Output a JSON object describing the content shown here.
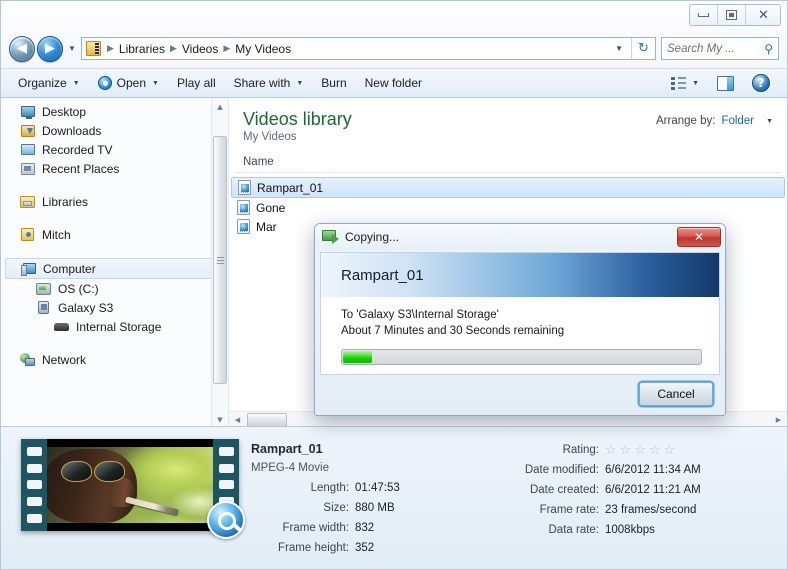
{
  "window": {
    "controls": {
      "minimize": "Minimize",
      "maximize": "Restore",
      "close": "✕"
    }
  },
  "address": {
    "back_label": "◀",
    "forward_label": "▶",
    "history_caret": "▼",
    "crumbs": [
      "Libraries",
      "Videos",
      "My Videos"
    ],
    "separator": "▶",
    "dropdown_caret": "▼",
    "refresh_label": "↻"
  },
  "search": {
    "placeholder": "Search My ...",
    "icon": "search-icon",
    "glyph": "⚲"
  },
  "toolbar": {
    "organize": "Organize",
    "open": "Open",
    "play_all": "Play all",
    "share_with": "Share with",
    "burn": "Burn",
    "new_folder": "New folder",
    "caret": "▼",
    "help_glyph": "?"
  },
  "sidebar": {
    "groups": [
      {
        "items": [
          {
            "label": "Desktop",
            "icon": "desktop-icon",
            "level": 1
          },
          {
            "label": "Downloads",
            "icon": "downloads-icon",
            "level": 1
          },
          {
            "label": "Recorded TV",
            "icon": "recorded-tv-icon",
            "level": 1
          },
          {
            "label": "Recent Places",
            "icon": "recent-places-icon",
            "level": 1
          }
        ]
      },
      {
        "items": [
          {
            "label": "Libraries",
            "icon": "libraries-icon",
            "level": 0
          }
        ]
      },
      {
        "items": [
          {
            "label": "Mitch",
            "icon": "user-folder-icon",
            "level": 0
          }
        ]
      },
      {
        "items": [
          {
            "label": "Computer",
            "icon": "computer-icon",
            "level": 0,
            "selected": true
          },
          {
            "label": "OS (C:)",
            "icon": "hard-drive-icon",
            "level": 1
          },
          {
            "label": "Galaxy S3",
            "icon": "phone-icon",
            "level": 1
          },
          {
            "label": "Internal Storage",
            "icon": "internal-storage-icon",
            "level": 2
          }
        ]
      },
      {
        "items": [
          {
            "label": "Network",
            "icon": "network-icon",
            "level": 0
          }
        ]
      }
    ]
  },
  "library": {
    "title": "Videos library",
    "subtitle": "My Videos",
    "arrange_label": "Arrange by:",
    "arrange_value": "Folder",
    "arrange_caret": "▼",
    "column_header": "Name",
    "files": [
      {
        "name": "Rampart_01",
        "selected": true
      },
      {
        "name": "Gone",
        "selected": false
      },
      {
        "name": "Mar",
        "selected": false
      }
    ]
  },
  "dialog": {
    "title": "Copying...",
    "close_label": "✕",
    "file_name": "Rampart_01",
    "destination_line": "To 'Galaxy S3\\Internal Storage'",
    "time_remaining_line": "About 7 Minutes and 30 Seconds remaining",
    "progress_percent": 8,
    "cancel_label": "Cancel"
  },
  "details": {
    "file_title": "Rampart_01",
    "file_type": "MPEG-4 Movie",
    "left_fields": [
      {
        "label": "Length:",
        "value": "01:47:53"
      },
      {
        "label": "Size:",
        "value": "880 MB"
      },
      {
        "label": "Frame width:",
        "value": "832"
      },
      {
        "label": "Frame height:",
        "value": "352"
      }
    ],
    "rating_label": "Rating:",
    "rating_stars": 5,
    "rating_filled": 0,
    "star_glyph": "☆",
    "right_fields": [
      {
        "label": "Date modified:",
        "value": "6/6/2012 11:34 AM"
      },
      {
        "label": "Date created:",
        "value": "6/6/2012 11:21 AM"
      },
      {
        "label": "Frame rate:",
        "value": "23 frames/second"
      },
      {
        "label": "Data rate:",
        "value": "1008kbps"
      }
    ]
  },
  "colors": {
    "library_title_green": "#1a6b2f",
    "link_blue": "#1667b3",
    "progress_green": "#15d400",
    "close_red": "#c0392f"
  }
}
